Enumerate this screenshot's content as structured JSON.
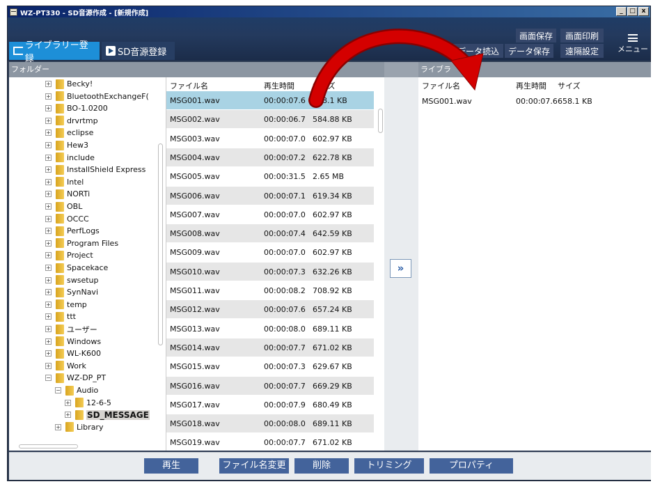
{
  "window": {
    "title": "WZ-PT330 - SD音源作成 - [新規作成]",
    "controls": [
      "_",
      "□",
      "x"
    ]
  },
  "toolbar": {
    "tab_library": "ライブラリー登録",
    "tab_sd": "SD音源登録",
    "screen_save": "画面保存",
    "screen_print": "画面印刷",
    "data_load": "データ読込",
    "data_save": "データ保存",
    "remote_settings": "遠隔設定",
    "menu": "メニュー"
  },
  "folder_panel": {
    "header": "フォルダー",
    "items": [
      {
        "label": "Becky!",
        "expander": "+"
      },
      {
        "label": "BluetoothExchangeF(",
        "expander": "+"
      },
      {
        "label": "BO-1.0200",
        "expander": "+"
      },
      {
        "label": "drvrtmp",
        "expander": "+"
      },
      {
        "label": "eclipse",
        "expander": "+"
      },
      {
        "label": "Hew3",
        "expander": "+"
      },
      {
        "label": "include",
        "expander": "+"
      },
      {
        "label": "InstallShield Express",
        "expander": "+"
      },
      {
        "label": "Intel",
        "expander": "+"
      },
      {
        "label": "NORTi",
        "expander": "+"
      },
      {
        "label": "OBL",
        "expander": "+"
      },
      {
        "label": "OCCC",
        "expander": "+"
      },
      {
        "label": "PerfLogs",
        "expander": "+"
      },
      {
        "label": "Program Files",
        "expander": "+"
      },
      {
        "label": "Project",
        "expander": "+"
      },
      {
        "label": "Spacekace",
        "expander": "+"
      },
      {
        "label": "swsetup",
        "expander": "+"
      },
      {
        "label": "SynNavi",
        "expander": "+"
      },
      {
        "label": "temp",
        "expander": "+"
      },
      {
        "label": "ttt",
        "expander": "+"
      },
      {
        "label": "ユーザー",
        "expander": "+"
      },
      {
        "label": "Windows",
        "expander": "+"
      },
      {
        "label": "WL-K600",
        "expander": "+"
      },
      {
        "label": "Work",
        "expander": "+"
      },
      {
        "label": "WZ-DP_PT",
        "expander": "−"
      },
      {
        "label": "Audio",
        "expander": "−",
        "indent": 1
      },
      {
        "label": "12-6-5",
        "expander": "+",
        "indent": 2
      },
      {
        "label": "SD_MESSAGE",
        "expander": "+",
        "indent": 2,
        "selected": true
      },
      {
        "label": "Library",
        "expander": "+",
        "indent": 1
      }
    ]
  },
  "file_list": {
    "columns": {
      "name": "ファイル名",
      "time": "再生時間",
      "size": "サイズ"
    },
    "rows": [
      {
        "name": "MSG001.wav",
        "time": "00:00:07.6",
        "size": "658.1 KB"
      },
      {
        "name": "MSG002.wav",
        "time": "00:00:06.7",
        "size": "584.88 KB"
      },
      {
        "name": "MSG003.wav",
        "time": "00:00:07.0",
        "size": "602.97 KB"
      },
      {
        "name": "MSG004.wav",
        "time": "00:00:07.2",
        "size": "622.78 KB"
      },
      {
        "name": "MSG005.wav",
        "time": "00:00:31.5",
        "size": "2.65 MB"
      },
      {
        "name": "MSG006.wav",
        "time": "00:00:07.1",
        "size": "619.34 KB"
      },
      {
        "name": "MSG007.wav",
        "time": "00:00:07.0",
        "size": "602.97 KB"
      },
      {
        "name": "MSG008.wav",
        "time": "00:00:07.4",
        "size": "642.59 KB"
      },
      {
        "name": "MSG009.wav",
        "time": "00:00:07.0",
        "size": "602.97 KB"
      },
      {
        "name": "MSG010.wav",
        "time": "00:00:07.3",
        "size": "632.26 KB"
      },
      {
        "name": "MSG011.wav",
        "time": "00:00:08.2",
        "size": "708.92 KB"
      },
      {
        "name": "MSG012.wav",
        "time": "00:00:07.6",
        "size": "657.24 KB"
      },
      {
        "name": "MSG013.wav",
        "time": "00:00:08.0",
        "size": "689.11 KB"
      },
      {
        "name": "MSG014.wav",
        "time": "00:00:07.7",
        "size": "671.02 KB"
      },
      {
        "name": "MSG015.wav",
        "time": "00:00:07.3",
        "size": "629.67 KB"
      },
      {
        "name": "MSG016.wav",
        "time": "00:00:07.7",
        "size": "669.29 KB"
      },
      {
        "name": "MSG017.wav",
        "time": "00:00:07.9",
        "size": "680.49 KB"
      },
      {
        "name": "MSG018.wav",
        "time": "00:00:08.0",
        "size": "689.11 KB"
      },
      {
        "name": "MSG019.wav",
        "time": "00:00:07.7",
        "size": "671.02 KB"
      }
    ]
  },
  "add_button": "»",
  "library_panel": {
    "header": "ライブラ",
    "columns": {
      "name": "ファイル名",
      "time": "再生時間",
      "size": "サイズ"
    },
    "rows": [
      {
        "name": "MSG001.wav",
        "time": "00:00:07.6",
        "size": "658.1 KB"
      }
    ]
  },
  "bottom_buttons": {
    "play": "再生",
    "rename": "ファイル名変更",
    "delete": "削除",
    "trim": "トリミング",
    "properties": "プロパティ"
  },
  "colors": {
    "active_tab": "#1d8fd8",
    "selected_row": "#a9d3e4",
    "annotation_arrow": "#d40000"
  },
  "icons": [
    "app-icon",
    "library-tab-icon",
    "sd-tab-icon",
    "folder-icon",
    "menu-icon",
    "annotation-arrow"
  ]
}
